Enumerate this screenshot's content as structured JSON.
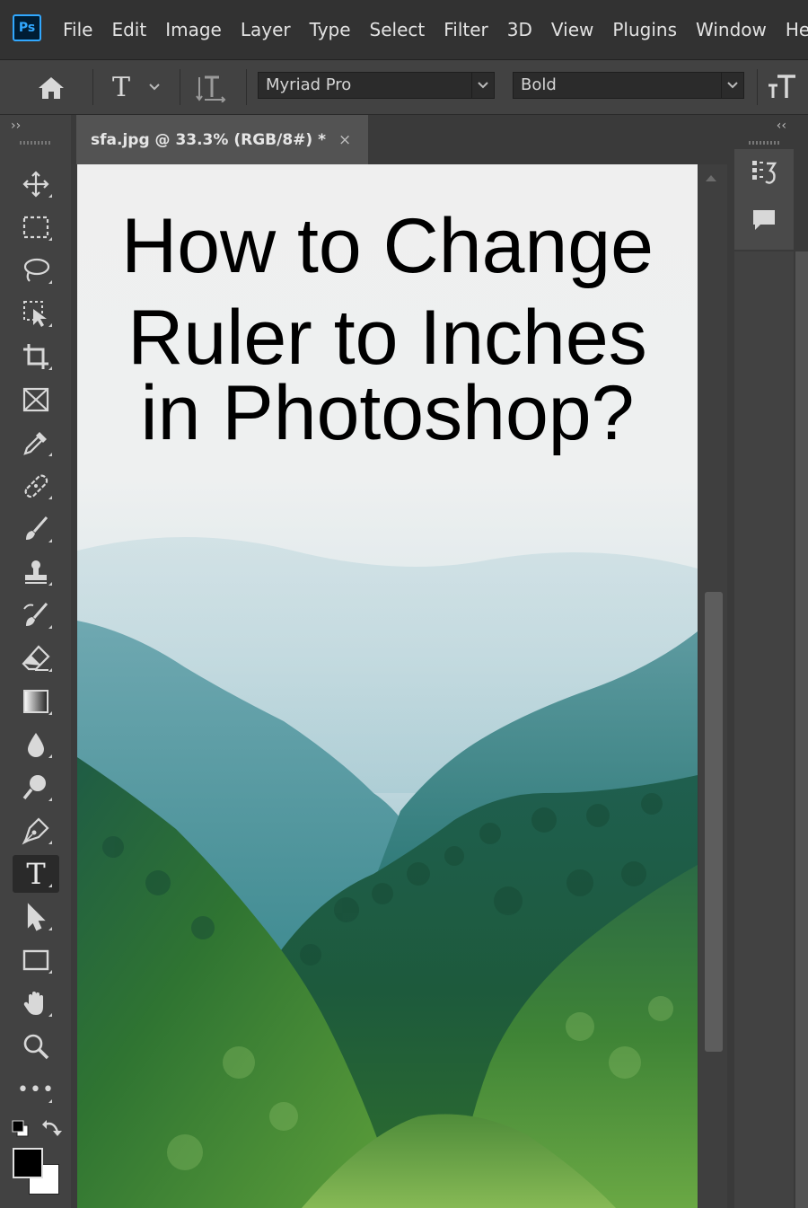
{
  "app": {
    "logo_text": "Ps"
  },
  "menu": {
    "items": [
      "File",
      "Edit",
      "Image",
      "Layer",
      "Type",
      "Select",
      "Filter",
      "3D",
      "View",
      "Plugins",
      "Window",
      "He"
    ]
  },
  "options_bar": {
    "font_family": "Myriad Pro",
    "font_style": "Bold",
    "tool_glyph": "T",
    "icons": [
      "home-icon",
      "text-tool-icon",
      "chevron-down-icon",
      "text-orientation-icon",
      "text-size-icon"
    ]
  },
  "document": {
    "tab_title": "sfa.jpg @ 33.3% (RGB/8#) *",
    "close_glyph": "×",
    "title_lines": [
      "How to Change",
      "Ruler to Inches",
      "in Photoshop?"
    ]
  },
  "toolbar": {
    "collapse_glyph": "››",
    "active_tool": "type-tool",
    "tools": [
      "move",
      "marquee",
      "lasso",
      "object-select",
      "crop",
      "frame",
      "eyedropper",
      "healing",
      "brush",
      "stamp",
      "history-brush",
      "eraser",
      "gradient",
      "blur",
      "dodge",
      "pen",
      "type",
      "path-select",
      "rectangle",
      "hand",
      "zoom",
      "more"
    ],
    "type_glyph": "T",
    "more_glyph": "•••",
    "foreground_color": "#000000",
    "background_color": "#ffffff"
  },
  "right_dock": {
    "collapse_glyph": "‹‹",
    "icons": [
      "properties-icon",
      "comment-icon"
    ]
  },
  "colors": {
    "menubar": "#323232",
    "panel": "#424242",
    "workspace": "#535353",
    "accent": "#31a8ff"
  }
}
